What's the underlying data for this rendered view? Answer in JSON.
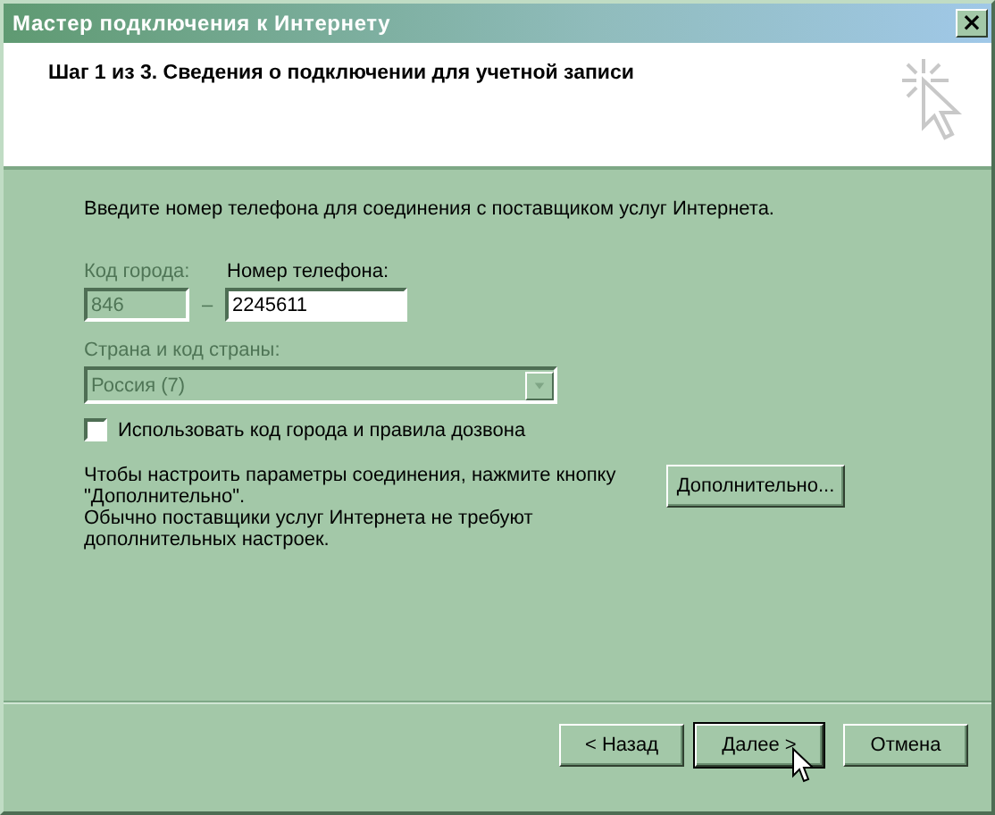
{
  "window": {
    "title": "Мастер подключения к Интернету",
    "close_icon": "×"
  },
  "header": {
    "title": "Шаг 1 из 3. Сведения о подключении для учетной записи"
  },
  "intro": "Введите номер телефона для соединения с поставщиком услуг Интернета.",
  "area_code": {
    "label": "Код города:",
    "value": "846",
    "disabled": true
  },
  "separator": "–",
  "phone": {
    "label": "Номер телефона:",
    "value": "2245611",
    "disabled": false
  },
  "country": {
    "label": "Страна и код страны:",
    "value": "Россия (7)",
    "disabled": true
  },
  "dialing_rules": {
    "label": "Использовать код города и правила дозвона",
    "checked": false
  },
  "notes": [
    "Чтобы настроить параметры соединения, нажмите кнопку \"Дополнительно\".",
    "Обычно поставщики услуг Интернета не требуют дополнительных настроек."
  ],
  "advanced_button": "Дополнительно...",
  "buttons": [
    {
      "label": "< Назад",
      "default": false
    },
    {
      "label": "Далее >",
      "default": true
    },
    {
      "label": "Отмена",
      "default": false
    }
  ]
}
